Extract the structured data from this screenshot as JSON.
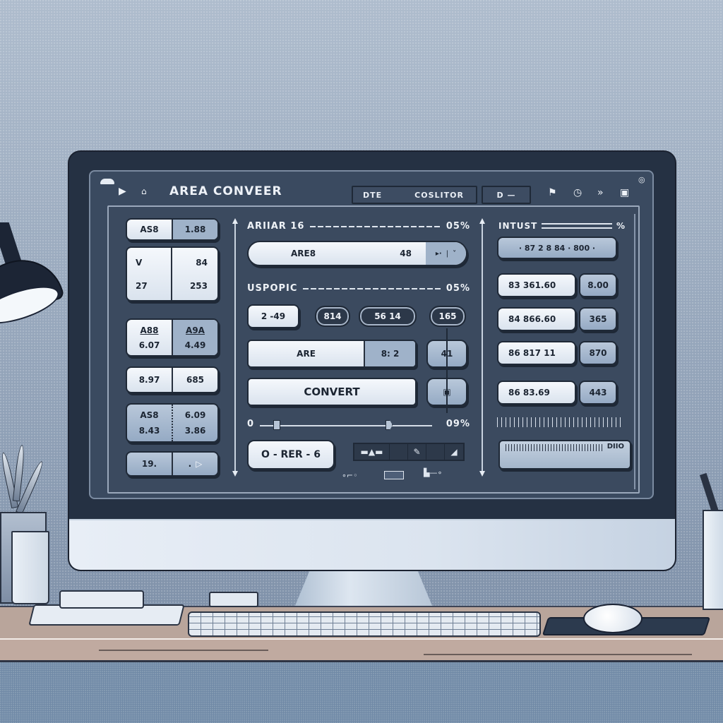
{
  "window": {
    "title": "AREA CONVEER",
    "toolbar_fields": [
      "DTE",
      "COSLITOR",
      "D —"
    ],
    "icons": [
      "play-icon",
      "home-icon",
      "flag-icon",
      "clock-icon",
      "share-icon",
      "save-icon",
      "help-icon"
    ]
  },
  "left_panel": {
    "row1": [
      "AS8",
      "1.88"
    ],
    "row2": {
      "left": [
        "V",
        "27"
      ],
      "right": [
        "84",
        "253"
      ]
    },
    "row3": {
      "left": [
        "A88",
        "6.07"
      ],
      "right": [
        "A9A",
        "4.49"
      ]
    },
    "row4": [
      "8.97",
      "685"
    ],
    "row5": {
      "left": [
        "AS8",
        "8.43"
      ],
      "right": [
        "6.09",
        "3.86"
      ]
    },
    "row6": [
      "19.",
      "."
    ]
  },
  "center_panel": {
    "header1": {
      "label": "ARIIAR 16",
      "value": "05%"
    },
    "area_field": {
      "label": "ARE8",
      "value": "48"
    },
    "header2": {
      "label": "USPOPIC",
      "value": "05%"
    },
    "chips": [
      "2 -49",
      "814",
      "56  14",
      "165"
    ],
    "are_field": {
      "label": "ARE",
      "value": "8: 2"
    },
    "side_button_1": "41",
    "convert_label": "CONVERT",
    "slider": {
      "min_label": "0",
      "value_label": "09%",
      "start": 0.1,
      "end": 0.75
    },
    "output_button": "O - RER - 6"
  },
  "right_panel": {
    "header": "INTUST",
    "display": "· 87  2 8  84 · 800 ·",
    "rows": [
      {
        "value": "83   361.60",
        "unit": "8.00"
      },
      {
        "value": "84   866.60",
        "unit": "365"
      },
      {
        "value": "86   817  11",
        "unit": "870"
      },
      {
        "value": "86   83.69",
        "unit": "443"
      }
    ],
    "lcd_label": "DIIO"
  }
}
